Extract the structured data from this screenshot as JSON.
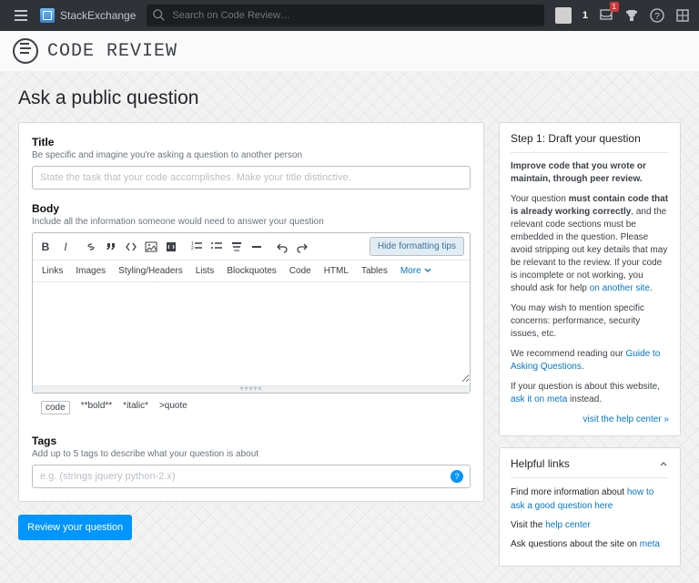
{
  "topbar": {
    "brand": "StackExchange",
    "search_placeholder": "Search on Code Review…",
    "rep": "1",
    "inbox_count": "1"
  },
  "site": {
    "name": "CODE REVIEW"
  },
  "page": {
    "title": "Ask a public question"
  },
  "title_field": {
    "label": "Title",
    "desc": "Be specific and imagine you're asking a question to another person",
    "placeholder": "State the task that your code accomplishes. Make your title distinctive."
  },
  "body_field": {
    "label": "Body",
    "desc": "Include all the information someone would need to answer your question",
    "hide_tips": "Hide formatting tips",
    "tabs": [
      "Links",
      "Images",
      "Styling/Headers",
      "Lists",
      "Blockquotes",
      "Code",
      "HTML",
      "Tables"
    ],
    "more": "More",
    "md": {
      "code": "code",
      "bold": "**bold**",
      "italic": "*italic*",
      "quote": ">quote"
    }
  },
  "tags_field": {
    "label": "Tags",
    "desc": "Add up to 5 tags to describe what your question is about",
    "placeholder": "e.g. (strings jquery python-2.x)"
  },
  "review_button": "Review your question",
  "step": {
    "head": "Step 1: Draft your question",
    "intro": "Improve code that you wrote or maintain, through peer review.",
    "para1a": "Your question ",
    "para1b": "must contain code that is already working correctly",
    "para1c": ", and the relevant code sections must be embedded in the question. Please avoid stripping out key details that may be relevant to the review. If your code is incomplete or not working, you should ask for help ",
    "para1link": "on another site",
    "para1d": ".",
    "para2": "You may wish to mention specific concerns: performance, security issues, etc.",
    "para3a": "We recommend reading our ",
    "para3link": "Guide to Asking Questions",
    "para3b": ".",
    "para4a": "If your question is about this website, ",
    "para4link": "ask it on meta",
    "para4b": " instead.",
    "foot": "visit the help center »"
  },
  "help": {
    "head": "Helpful links",
    "p1a": "Find more information about ",
    "p1link": "how to ask a good question here",
    "p2a": "Visit the ",
    "p2link": "help center",
    "p3a": "Ask questions about the site on ",
    "p3link": "meta"
  }
}
